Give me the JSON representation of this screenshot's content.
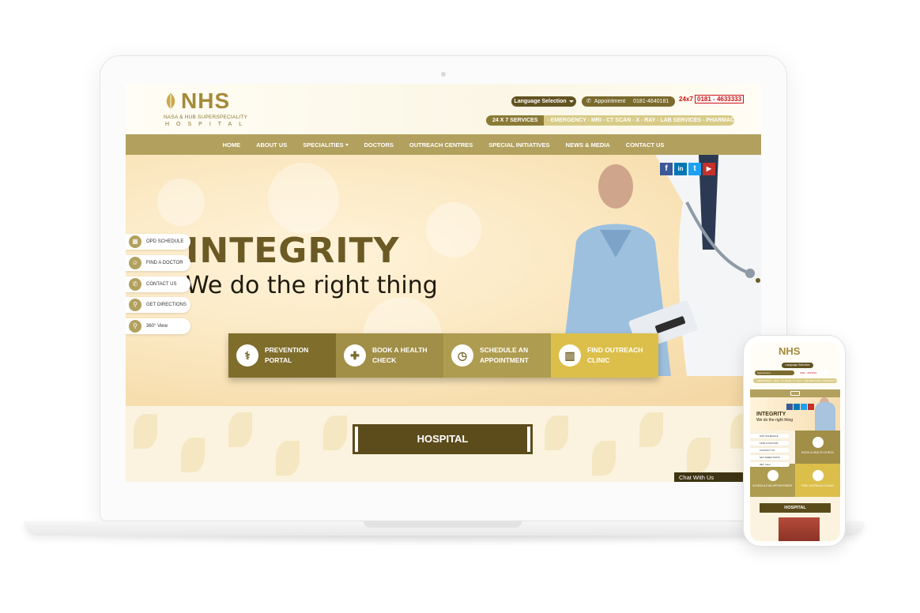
{
  "brand": {
    "logo_text": "NHS",
    "logo_sub": "NASA & HUB SUPERSPECIALITY",
    "logo_hospital": "HOSPITAL"
  },
  "topbar": {
    "language_label": "Language Selection",
    "appointment_label": "Appointment",
    "appointment_phone": "0181-4640181",
    "emergency_prefix": "24x7",
    "emergency_phone": "0181 - 4633333",
    "services_left": "24   X   7   SERVICES",
    "services_right": "- EMERGENCY - MRI - CT SCAN - X - RAY - LAB SERVICES - PHARMACY -"
  },
  "nav": {
    "items": [
      {
        "label": "HOME"
      },
      {
        "label": "ABOUT US"
      },
      {
        "label": "SPECIALITIES"
      },
      {
        "label": "DOCTORS"
      },
      {
        "label": "OUTREACH CENTRES"
      },
      {
        "label": "SPECIAL INITIATIVES"
      },
      {
        "label": "NEWS & MEDIA"
      },
      {
        "label": "CONTACT US"
      }
    ]
  },
  "hero": {
    "title": "INTEGRITY",
    "subtitle": "We do the right thing"
  },
  "social": {
    "facebook": "f",
    "linkedin": "in",
    "twitter": "t",
    "youtube": "▶"
  },
  "side_menu": [
    {
      "label": "OPD SCHEDULE",
      "icon": "calendar-icon"
    },
    {
      "label": "FIND A DOCTOR",
      "icon": "doctor-icon"
    },
    {
      "label": "CONTACT US",
      "icon": "phone-icon"
    },
    {
      "label": "GET DIRECTIONS",
      "icon": "location-pin-icon"
    },
    {
      "label": "360° View",
      "icon": "location-pin-icon"
    }
  ],
  "cta": [
    {
      "label": "PREVENTION PORTAL"
    },
    {
      "label": "BOOK A HEALTH CHECK"
    },
    {
      "label": "SCHEDULE AN APPOINTMENT"
    },
    {
      "label": "FIND OUTREACH CLINIC"
    }
  ],
  "section": {
    "hospital_heading": "HOSPITAL"
  },
  "chat": {
    "label": "Chat With Us"
  },
  "mobile": {
    "logo_text": "NHS",
    "language_label": "Language Selection",
    "title": "INTEGRITY",
    "subtitle": "We do the right thing",
    "tiles": [
      "BOOK A HEALTH CHECK",
      "SCHEDULE AN APPOINTMENT",
      "FIND OUTREACH CLINIC"
    ],
    "hospital_heading": "HOSPITAL"
  },
  "colors": {
    "gold": "#b2a15e",
    "dark_gold": "#5c4c1c",
    "yellow": "#dcbf4a"
  }
}
